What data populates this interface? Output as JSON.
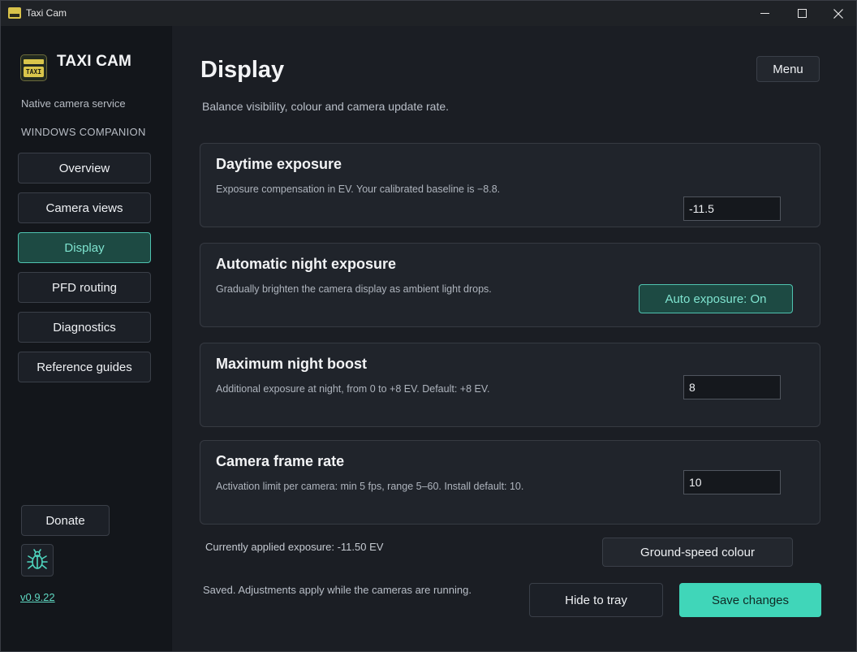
{
  "window": {
    "title": "Taxi Cam"
  },
  "sidebar": {
    "brand": "TAXI CAM",
    "logo_text": "TAXI",
    "service": "Native camera service",
    "companion": "WINDOWS COMPANION",
    "nav": [
      {
        "label": "Overview",
        "active": false
      },
      {
        "label": "Camera views",
        "active": false
      },
      {
        "label": "Display",
        "active": true
      },
      {
        "label": "PFD routing",
        "active": false
      },
      {
        "label": "Diagnostics",
        "active": false
      },
      {
        "label": "Reference guides",
        "active": false
      }
    ],
    "donate": "Donate",
    "bug_icon": "bug-icon",
    "version": "v0.9.22"
  },
  "main": {
    "title": "Display",
    "menu": "Menu",
    "subtitle": "Balance visibility, colour and camera update rate.",
    "cards": {
      "daytime": {
        "title": "Daytime exposure",
        "desc": "Exposure compensation in EV. Your calibrated baseline is −8.8.",
        "value": "-11.5"
      },
      "night": {
        "title": "Automatic night exposure",
        "desc": "Gradually brighten the camera display as ambient light drops.",
        "toggle": "Auto exposure: On"
      },
      "boost": {
        "title": "Maximum night boost",
        "desc": "Additional exposure at night, from 0 to +8 EV. Default: +8 EV.",
        "value": "8"
      },
      "framerate": {
        "title": "Camera frame rate",
        "desc": "Activation limit per camera: min 5 fps, range 5–60. Install default: 10.",
        "value": "10"
      }
    },
    "applied": "Currently applied exposure: -11.50 EV",
    "ground_speed": "Ground-speed colour",
    "saved": "Saved. Adjustments apply while the cameras are running.",
    "hide": "Hide to tray",
    "save": "Save changes"
  },
  "colors": {
    "accent": "#40d6b9",
    "active_nav_bg": "#1d4a43",
    "logo_yellow": "#d9c54b"
  }
}
